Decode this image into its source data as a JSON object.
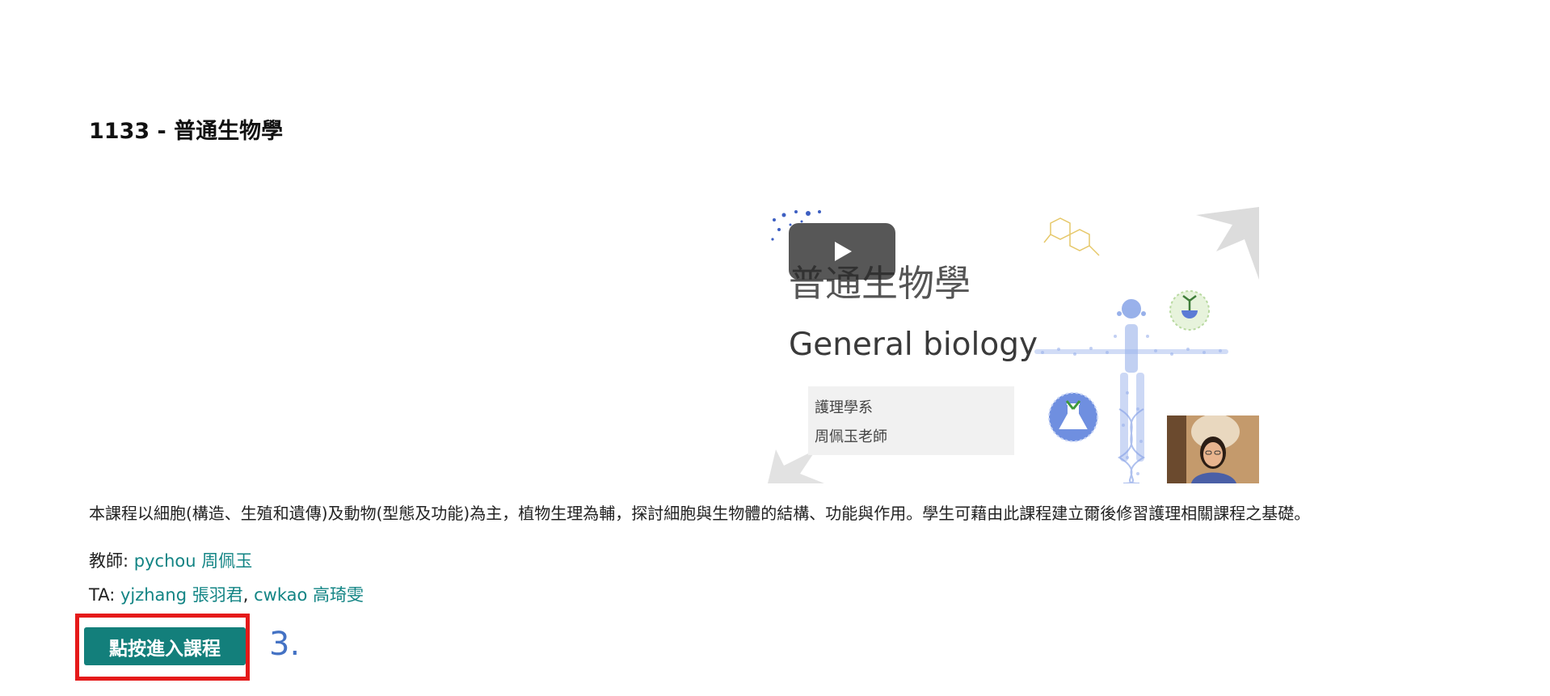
{
  "course": {
    "title": "1133 - 普通生物學",
    "description": "本課程以細胞(構造、生殖和遺傳)及動物(型態及功能)為主，植物生理為輔，探討細胞與生物體的結構、功能與作用。學生可藉由此課程建立爾後修習護理相關課程之基礎。"
  },
  "video": {
    "title_zh": "普通生物學",
    "title_en": "General biology",
    "department": "護理學系",
    "teacher": "周佩玉老師",
    "play_icon": "play-icon",
    "accent_color": "#5b7bd5"
  },
  "instructors": {
    "teacher_label": "教師: ",
    "teacher_link": "pychou 周佩玉",
    "ta_label": "TA: ",
    "ta_links": [
      "yjzhang 張羽君",
      "cwkao 高琦雯"
    ],
    "ta_separator": ", "
  },
  "actions": {
    "enter_button": "點按進入課程",
    "step_label": "3."
  },
  "colors": {
    "link": "#128484",
    "button": "#137f7b",
    "highlight": "#e51a1a",
    "step": "#4472c4"
  }
}
